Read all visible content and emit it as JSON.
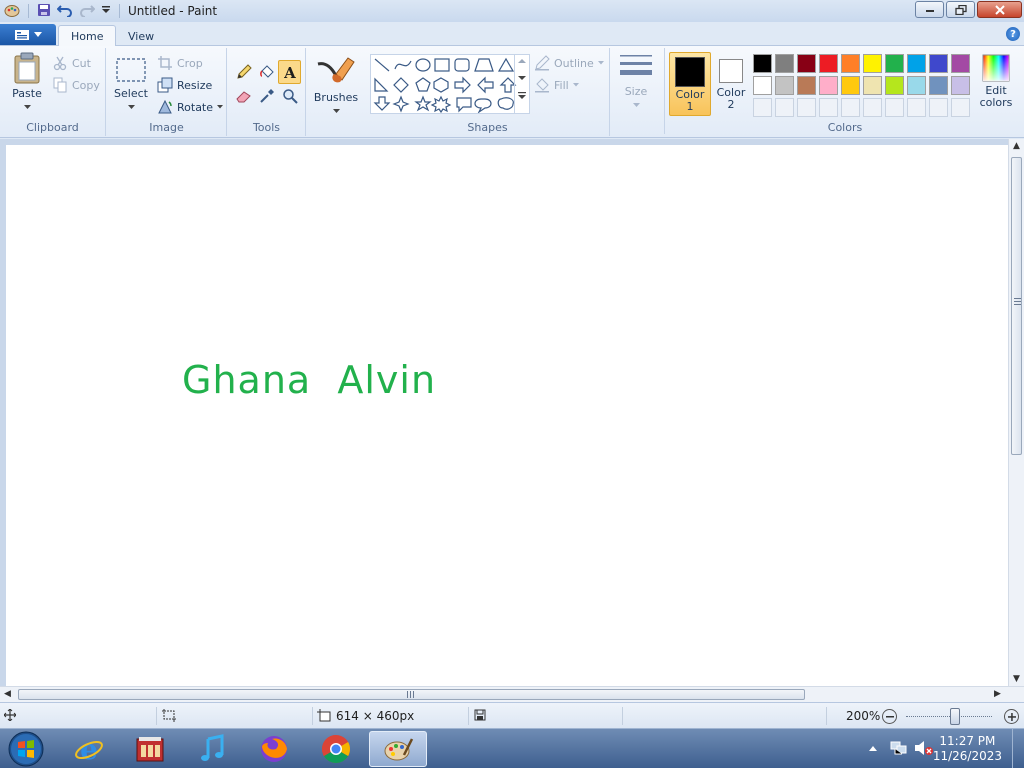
{
  "window": {
    "title": "Untitled - Paint"
  },
  "tabs": [
    {
      "label": "Home",
      "active": true
    },
    {
      "label": "View",
      "active": false
    }
  ],
  "ribbon": {
    "clipboard": {
      "group_label": "Clipboard",
      "paste": "Paste",
      "cut": "Cut",
      "copy": "Copy"
    },
    "image": {
      "group_label": "Image",
      "select": "Select",
      "crop": "Crop",
      "resize": "Resize",
      "rotate": "Rotate"
    },
    "tools": {
      "group_label": "Tools"
    },
    "brushes": {
      "label": "Brushes"
    },
    "shapes": {
      "group_label": "Shapes",
      "outline": "Outline",
      "fill": "Fill"
    },
    "size": {
      "label": "Size"
    },
    "colors": {
      "group_label": "Colors",
      "color1": "Color 1",
      "color1_line1": "Color",
      "color1_line2": "1",
      "color2_line1": "Color",
      "color2_line2": "2",
      "edit_line1": "Edit",
      "edit_line2": "colors",
      "color1_value": "#000000",
      "color2_value": "#ffffff",
      "palette_row1": [
        "#000000",
        "#7f7f7f",
        "#880015",
        "#ed1c24",
        "#ff7f27",
        "#fff200",
        "#22b14c",
        "#00a2e8",
        "#3f48cc",
        "#a349a4"
      ],
      "palette_row2": [
        "#ffffff",
        "#c3c3c3",
        "#b97a57",
        "#ffaec9",
        "#ffc90e",
        "#efe4b0",
        "#b5e61d",
        "#99d9ea",
        "#7092be",
        "#c8bfe7"
      ]
    }
  },
  "canvas": {
    "text": "Ghana  Alvin",
    "text_color": "#22b14c"
  },
  "statusbar": {
    "dimensions": "614 × 460px",
    "zoom": "200%"
  },
  "taskbar": {
    "time": "11:27 PM",
    "date": "11/26/2023",
    "apps": [
      "start-orb",
      "internet-explorer",
      "media-center",
      "itunes",
      "firefox",
      "chrome",
      "paint"
    ]
  }
}
